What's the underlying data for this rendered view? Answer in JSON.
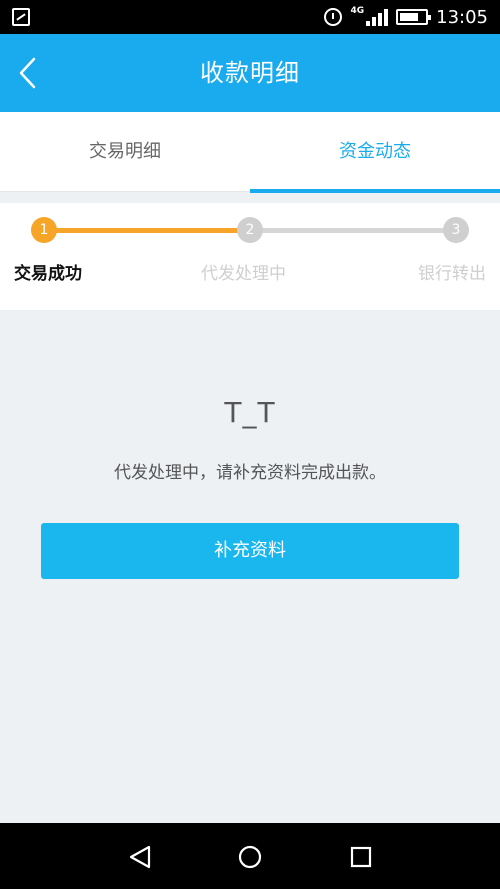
{
  "status_bar": {
    "network": "4G",
    "time": "13:05"
  },
  "header": {
    "title": "收款明细"
  },
  "tabs": [
    {
      "label": "交易明细",
      "active": false
    },
    {
      "label": "资金动态",
      "active": true
    }
  ],
  "progress": {
    "steps": [
      {
        "number": "1",
        "label": "交易成功",
        "state": "done"
      },
      {
        "number": "2",
        "label": "代发处理中",
        "state": "pending"
      },
      {
        "number": "3",
        "label": "银行转出",
        "state": "pending"
      }
    ]
  },
  "content": {
    "emoticon": "T_T",
    "message": "代发处理中，请补充资料完成出款。",
    "button_label": "补充资料"
  },
  "colors": {
    "brand": "#1aabee",
    "progress_done": "#f7a528",
    "progress_pending": "#d6d6d6"
  }
}
